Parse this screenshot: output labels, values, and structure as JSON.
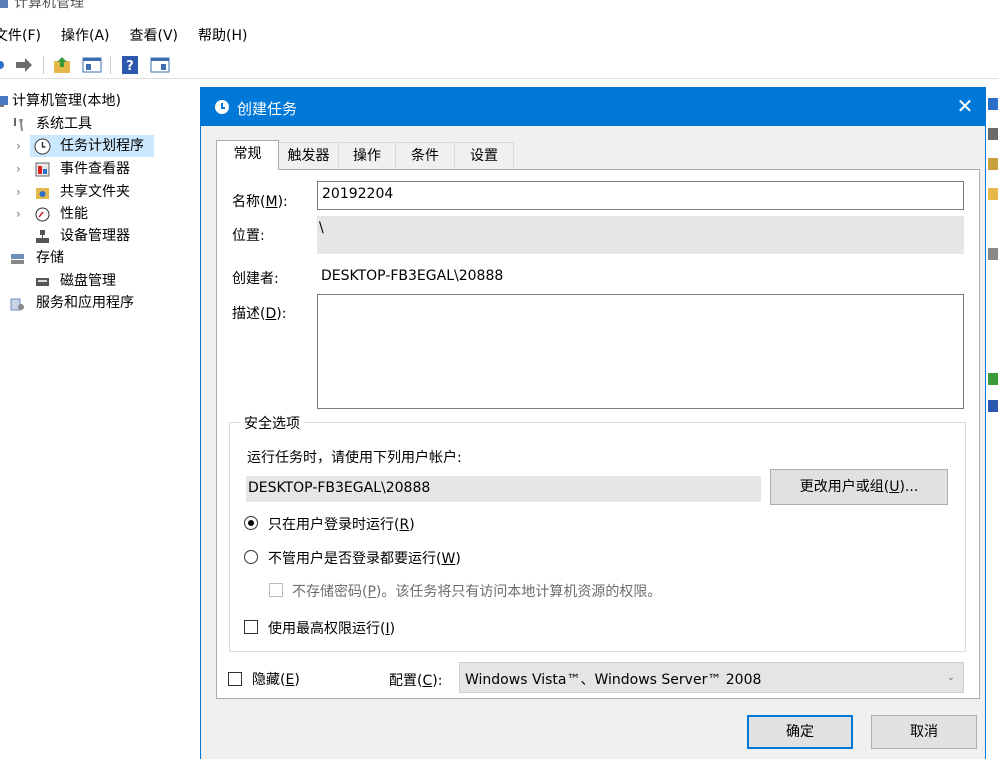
{
  "main_window": {
    "title": "计算机管理",
    "menu": [
      "文件(F)",
      "操作(A)",
      "查看(V)",
      "帮助(H)"
    ]
  },
  "tree": {
    "items": [
      {
        "label": "计算机管理(本地)",
        "icon": "computer-management-icon"
      },
      {
        "label": "系统工具",
        "icon": "tools-icon"
      },
      {
        "label": "任务计划程序",
        "icon": "clock-icon",
        "selected": true
      },
      {
        "label": "事件查看器",
        "icon": "event-viewer-icon"
      },
      {
        "label": "共享文件夹",
        "icon": "shared-folder-icon"
      },
      {
        "label": "性能",
        "icon": "performance-icon"
      },
      {
        "label": "设备管理器",
        "icon": "device-manager-icon"
      },
      {
        "label": "存储",
        "icon": "storage-icon"
      },
      {
        "label": "磁盘管理",
        "icon": "disk-icon"
      },
      {
        "label": "服务和应用程序",
        "icon": "services-icon"
      }
    ]
  },
  "dialog": {
    "title": "创建任务",
    "tabs": [
      "常规",
      "触发器",
      "操作",
      "条件",
      "设置"
    ],
    "name_label": "名称(",
    "name_key": "M",
    "name_suffix": "):",
    "name_value": "20192204",
    "location_label": "位置:",
    "location_value": "\\",
    "author_label": "创建者:",
    "author_value": "DESKTOP-FB3EGAL\\20888",
    "desc_label": "描述(",
    "desc_key": "D",
    "desc_suffix": "):",
    "desc_value": "",
    "security": {
      "legend": "安全选项",
      "run_as_prompt": "运行任务时，请使用下列用户帐户:",
      "account": "DESKTOP-FB3EGAL\\20888",
      "change_user_label": "更改用户或组(",
      "change_user_key": "U",
      "change_user_suffix": ")...",
      "radio_logged_on_label": "只在用户登录时运行(",
      "radio_logged_on_key": "R",
      "radio_logged_on_suffix": ")",
      "radio_logged_on_checked": true,
      "radio_any_label": "不管用户是否登录都要运行(",
      "radio_any_key": "W",
      "radio_any_suffix": ")",
      "radio_any_checked": false,
      "no_store_pw_label": "不存储密码(",
      "no_store_pw_key": "P",
      "no_store_pw_suffix": ")。该任务将只有访问本地计算机资源的权限。",
      "highest_priv_label": "使用最高权限运行(",
      "highest_priv_key": "I",
      "highest_priv_suffix": ")"
    },
    "hidden_label": "隐藏(",
    "hidden_key": "E",
    "hidden_suffix": ")",
    "config_label": "配置(",
    "config_key": "C",
    "config_suffix": "):",
    "config_value": "Windows Vista™、Windows Server™ 2008",
    "ok_label": "确定",
    "cancel_label": "取消"
  },
  "colors": {
    "title_bar": "#0078d7",
    "selection": "#cce8ff",
    "dialog_bg": "#f0f0f0"
  }
}
